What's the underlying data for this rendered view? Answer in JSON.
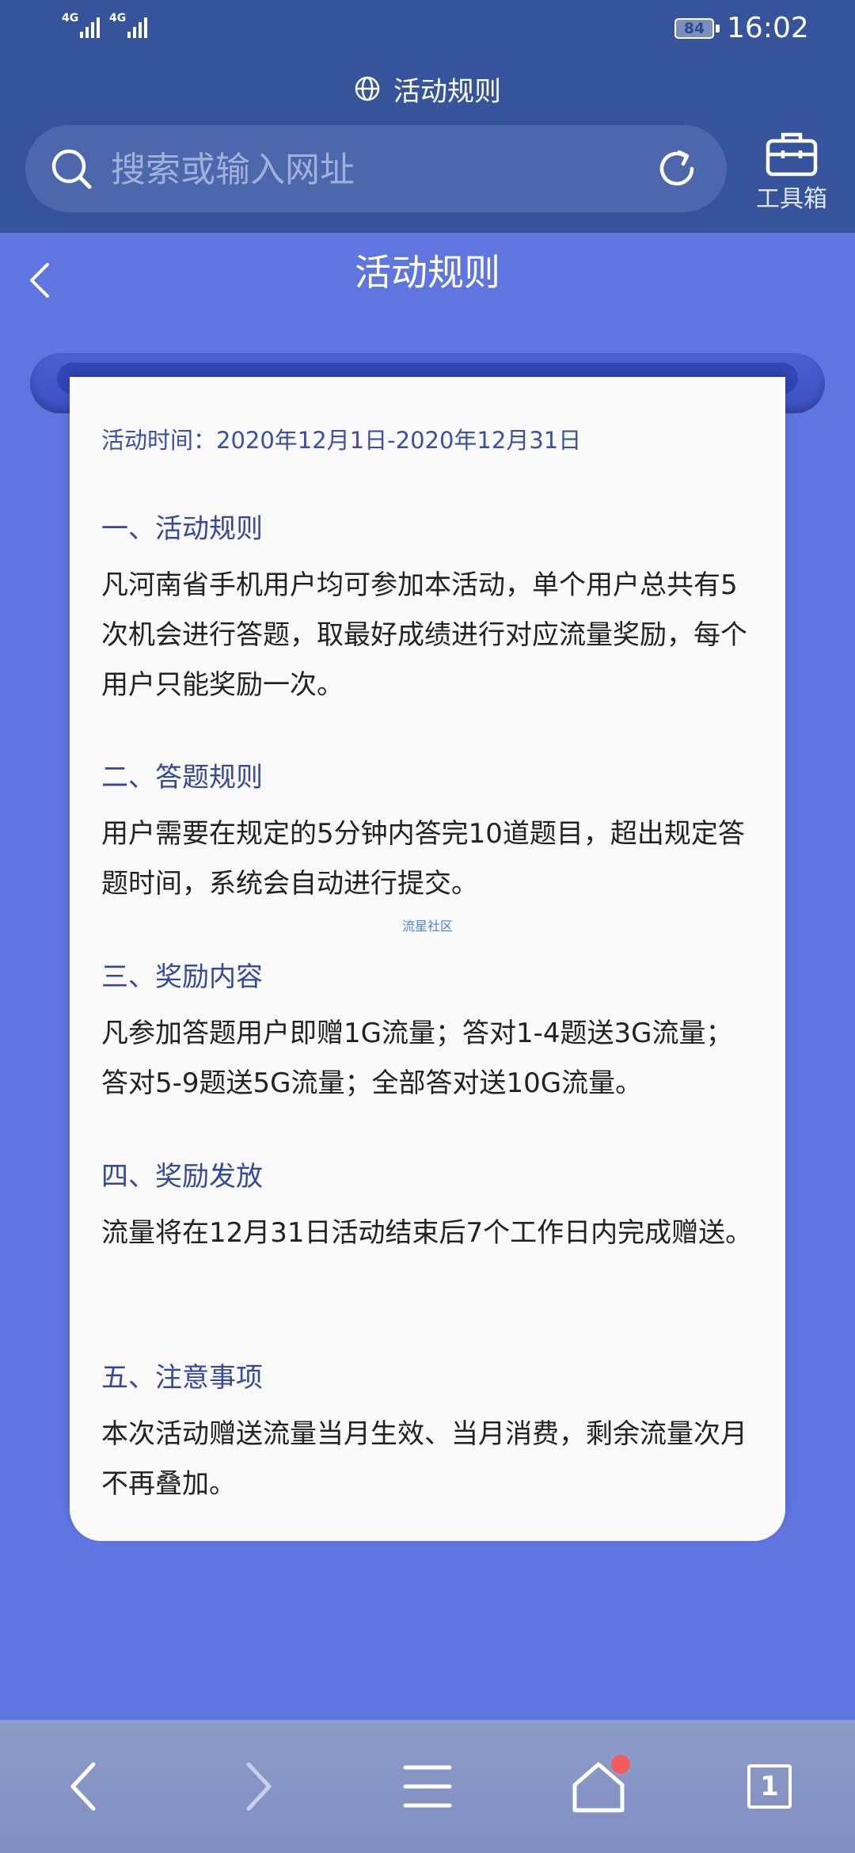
{
  "status_bar": {
    "network_1": "4G",
    "network_2": "4G",
    "battery": "84",
    "time": "16:02"
  },
  "browser": {
    "page_title": "活动规则",
    "search_placeholder": "搜索或输入网址",
    "toolbox_label": "工具箱"
  },
  "page": {
    "header_title": "活动规则",
    "activity_time": "活动时间：2020年12月1日-2020年12月31日",
    "watermark": "流星社区",
    "sections": [
      {
        "heading": "一、活动规则",
        "body": "凡河南省手机用户均可参加本活动，单个用户总共有5次机会进行答题，取最好成绩进行对应流量奖励，每个用户只能奖励一次。"
      },
      {
        "heading": "二、答题规则",
        "body": "用户需要在规定的5分钟内答完10道题目，超出规定答题时间，系统会自动进行提交。"
      },
      {
        "heading": "三、奖励内容",
        "body": "凡参加答题用户即赠1G流量；答对1-4题送3G流量；答对5-9题送5G流量；全部答对送10G流量。"
      },
      {
        "heading": "四、奖励发放",
        "body": "流量将在12月31日活动结束后7个工作日内完成赠送。"
      },
      {
        "heading": "五、注意事项",
        "body": "本次活动赠送流量当月生效、当月消费，剩余流量次月不再叠加。"
      }
    ]
  },
  "bottom_nav": {
    "tab_count": "1"
  },
  "colors": {
    "browser_bar": "#35549c",
    "page_background": "#5f75df",
    "heading_blue": "#34489f",
    "card": "#fafafa",
    "notification_dot": "#f25b5b"
  },
  "icons": {
    "globe": "globe-icon",
    "search": "search-icon",
    "refresh": "refresh-icon",
    "toolbox": "toolbox-icon",
    "back": "chevron-left-icon",
    "nav_back": "arrow-left-icon",
    "nav_forward": "arrow-right-icon",
    "nav_menu": "menu-icon",
    "nav_home": "home-icon",
    "nav_tabs": "tabs-icon"
  }
}
